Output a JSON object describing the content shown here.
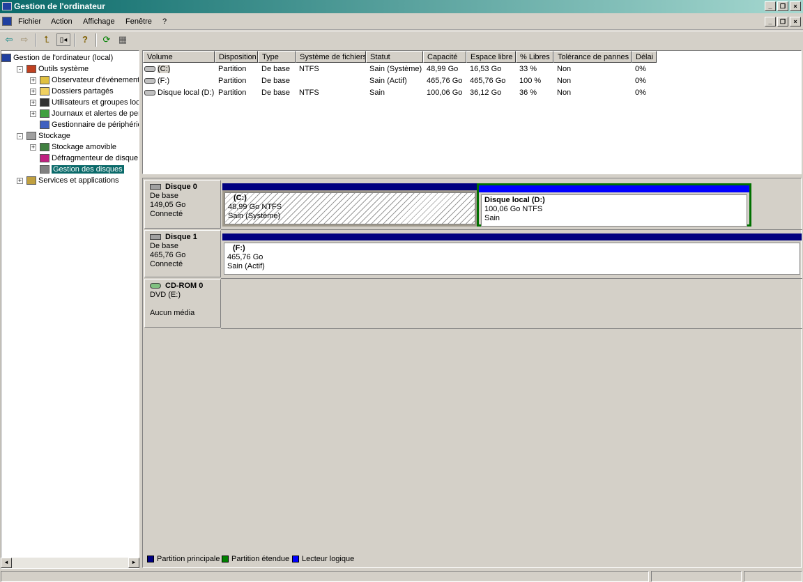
{
  "window": {
    "title": "Gestion de l'ordinateur"
  },
  "menu": [
    "Fichier",
    "Action",
    "Affichage",
    "Fenêtre",
    "?"
  ],
  "toolbar": [
    {
      "icon": "back-arrow-icon"
    },
    {
      "icon": "forward-arrow-icon"
    },
    {
      "icon": "up-folder-icon"
    },
    {
      "icon": "show-hide-tree-icon"
    },
    {
      "icon": "help-icon"
    },
    {
      "icon": "refresh-icon"
    },
    {
      "icon": "properties-icon"
    }
  ],
  "tree": [
    {
      "label": "Gestion de l'ordinateur (local)",
      "level": 0,
      "icon": "computer-icon"
    },
    {
      "label": "Outils système",
      "level": 1,
      "icon": "tools-icon",
      "expander": "-"
    },
    {
      "label": "Observateur d'événements",
      "level": 2,
      "icon": "event-viewer-icon",
      "expander": "+"
    },
    {
      "label": "Dossiers partagés",
      "level": 2,
      "icon": "shared-folder-icon",
      "expander": "+"
    },
    {
      "label": "Utilisateurs et groupes locaux",
      "level": 2,
      "icon": "users-icon",
      "expander": "+"
    },
    {
      "label": "Journaux et alertes de performance",
      "level": 2,
      "icon": "performance-icon",
      "expander": "+"
    },
    {
      "label": "Gestionnaire de périphériques",
      "level": 2,
      "icon": "device-manager-icon"
    },
    {
      "label": "Stockage",
      "level": 1,
      "icon": "storage-icon",
      "expander": "-"
    },
    {
      "label": "Stockage amovible",
      "level": 2,
      "icon": "removable-storage-icon",
      "expander": "+"
    },
    {
      "label": "Défragmenteur de disque",
      "level": 2,
      "icon": "defrag-icon"
    },
    {
      "label": "Gestion des disques",
      "level": 2,
      "icon": "disk-management-icon",
      "selected": true
    },
    {
      "label": "Services et applications",
      "level": 1,
      "icon": "services-icon",
      "expander": "+"
    }
  ],
  "volumes": {
    "columns": [
      "Volume",
      "Disposition",
      "Type",
      "Système de fichiers",
      "Statut",
      "Capacité",
      "Espace libre",
      "% Libres",
      "Tolérance de pannes",
      "Délai"
    ],
    "rows": [
      [
        "(C:)",
        "Partition",
        "De base",
        "NTFS",
        "Sain (Système)",
        "48,99 Go",
        "16,53 Go",
        "33 %",
        "Non",
        "0%"
      ],
      [
        "(F:)",
        "Partition",
        "De base",
        "",
        "Sain (Actif)",
        "465,76 Go",
        "465,76 Go",
        "100 %",
        "Non",
        "0%"
      ],
      [
        "Disque local (D:)",
        "Partition",
        "De base",
        "NTFS",
        "Sain",
        "100,06 Go",
        "36,12 Go",
        "36 %",
        "Non",
        "0%"
      ]
    ]
  },
  "disks": [
    {
      "name": "Disque 0",
      "type": "De base",
      "size": "149,05 Go",
      "status": "Connecté",
      "partitions": [
        {
          "name": "(C:)",
          "size": "48,99 Go NTFS",
          "status": "Sain (Système)",
          "kind": "primary"
        },
        {
          "name": "Disque local  (D:)",
          "size": "100,06 Go NTFS",
          "status": "Sain",
          "kind": "logical"
        }
      ]
    },
    {
      "name": "Disque 1",
      "type": "De base",
      "size": "465,76 Go",
      "status": "Connecté",
      "partitions": [
        {
          "name": "(F:)",
          "size": "465,76 Go",
          "status": "Sain (Actif)",
          "kind": "primary"
        }
      ]
    },
    {
      "name": "CD-ROM 0",
      "type": "DVD (E:)",
      "status": "Aucun média"
    }
  ],
  "legend": [
    {
      "label": "Partition principale",
      "color": "#000080"
    },
    {
      "label": "Partition étendue",
      "color": "#008000"
    },
    {
      "label": "Lecteur logique",
      "color": "#0000ff"
    }
  ]
}
